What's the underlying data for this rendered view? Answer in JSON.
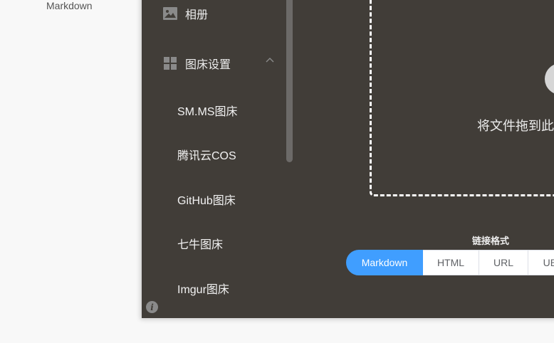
{
  "background": {
    "left_item_label": "Markdown"
  },
  "sidebar": {
    "items": [
      {
        "label": "相册",
        "icon": "image-icon"
      },
      {
        "label": "图床设置",
        "icon": "grid-icon",
        "expanded": true
      }
    ],
    "submenu": [
      {
        "label": "SM.MS图床"
      },
      {
        "label": "腾讯云COS"
      },
      {
        "label": "GitHub图床"
      },
      {
        "label": "七牛图床"
      },
      {
        "label": "Imgur图床"
      }
    ],
    "info_icon": "i"
  },
  "main": {
    "drop_text": "将文件拖到此",
    "link_format_label": "链接格式",
    "formats": [
      {
        "label": "Markdown",
        "selected": true
      },
      {
        "label": "HTML"
      },
      {
        "label": "URL"
      },
      {
        "label": "UBB"
      }
    ]
  },
  "colors": {
    "app_bg": "#413d38",
    "accent": "#409eff",
    "page_bg": "#f8f8f8"
  }
}
